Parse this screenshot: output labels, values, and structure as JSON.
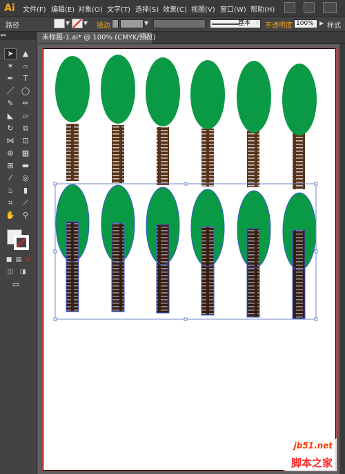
{
  "app": {
    "logo": "Ai"
  },
  "menu": {
    "items": [
      "文件(F)",
      "编辑(E)",
      "对象(O)",
      "文字(T)",
      "选择(S)",
      "效果(C)",
      "视图(V)",
      "窗口(W)",
      "帮助(H)"
    ]
  },
  "controlbar": {
    "label_path": "路径",
    "stroke_label": "描边",
    "stroke_style": "基本",
    "opacity_label": "不透明度",
    "opacity_value": "100%",
    "style_label": "样式"
  },
  "document": {
    "tab_title": "未标题-1.ai* @ 100% (CMYK/预览)",
    "close_glyph": "×"
  },
  "colors": {
    "tree_green": "#0a9a45",
    "trunk_brown": "#5a3318",
    "trunk_stripe": "#c4c4c4",
    "selection_blue": "#3a5dd8",
    "accent_orange": "#f7a21b"
  },
  "watermark": {
    "url": "jb51.net",
    "name": "脚本之家"
  }
}
